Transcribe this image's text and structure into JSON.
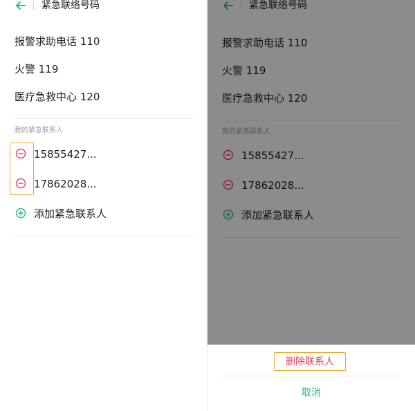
{
  "header": {
    "title": "紧急联络号码"
  },
  "emergency_numbers": [
    "报警求助电话 110",
    "火警 119",
    "医疗急救中心 120"
  ],
  "contacts_section": {
    "label": "我的紧急联系人"
  },
  "contacts": [
    "15855427...",
    "17862028..."
  ],
  "add_contact": {
    "label": "添加紧急联系人"
  },
  "action_sheet": {
    "delete_label": "删除联系人",
    "cancel_label": "取消"
  },
  "colors": {
    "accent_green": "#30b57a",
    "remove_red": "#e8435d",
    "highlight_orange": "#f5a623"
  },
  "icons": {
    "back": "arrow-left-icon",
    "remove": "minus-circle-icon",
    "add": "plus-circle-icon"
  }
}
